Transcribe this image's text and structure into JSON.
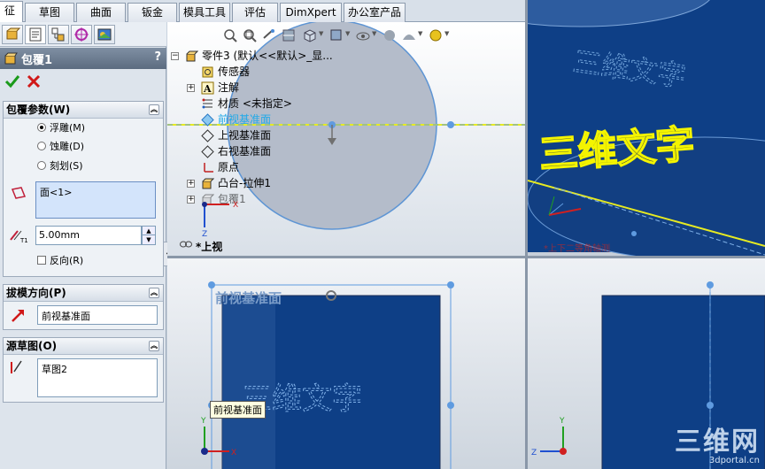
{
  "command_tabs": [
    {
      "label": "征",
      "active": true
    },
    {
      "label": "草图",
      "active": false
    },
    {
      "label": "曲面",
      "active": false
    },
    {
      "label": "钣金",
      "active": false
    },
    {
      "label": "模具工具",
      "active": false
    },
    {
      "label": "评估",
      "active": false
    },
    {
      "label": "DimXpert",
      "active": false
    },
    {
      "label": "办公室产品",
      "active": false
    }
  ],
  "property_manager": {
    "title": "包覆1",
    "help": "?",
    "tab_icons": [
      "feature-manager-icon",
      "property-manager-icon",
      "configuration-manager-icon",
      "dimxpert-manager-icon",
      "display-manager-icon"
    ],
    "wrap_params": {
      "header": "包覆参数(W)",
      "options": [
        {
          "label": "浮雕(M)",
          "selected": true
        },
        {
          "label": "蚀雕(D)",
          "selected": false
        },
        {
          "label": "刻划(S)",
          "selected": false
        }
      ],
      "face_selection": "面<1>",
      "thickness": "5.00mm",
      "reverse_label": "反向(R)",
      "reverse_checked": false
    },
    "pull_direction": {
      "header": "拔模方向(P)",
      "value": "前视基准面"
    },
    "source_sketch": {
      "header": "源草图(O)",
      "value": "草图2"
    }
  },
  "feature_tree": {
    "part": "零件3  (默认<<默认>_显...",
    "items": [
      "传感器",
      "注解",
      "材质 <未指定>",
      "前视基准面",
      "上视基准面",
      "右视基准面",
      "原点",
      "凸台-拉伸1",
      "包覆1"
    ],
    "highlighted": "前视基准面"
  },
  "viewports": {
    "top_left_label": "*上视",
    "top_right_text": "三维文字",
    "bottom_left_plane": "前视基准面",
    "tooltip": "前视基准面",
    "top_right_view_hint": "*上下二等角轴测"
  },
  "watermark": {
    "main": "三维网",
    "sub": "3dportal.cn"
  },
  "colors": {
    "part_blue": "#0e3f86",
    "highlight_yellow": "#f0f000",
    "selection_blue": "#3c8be0"
  }
}
